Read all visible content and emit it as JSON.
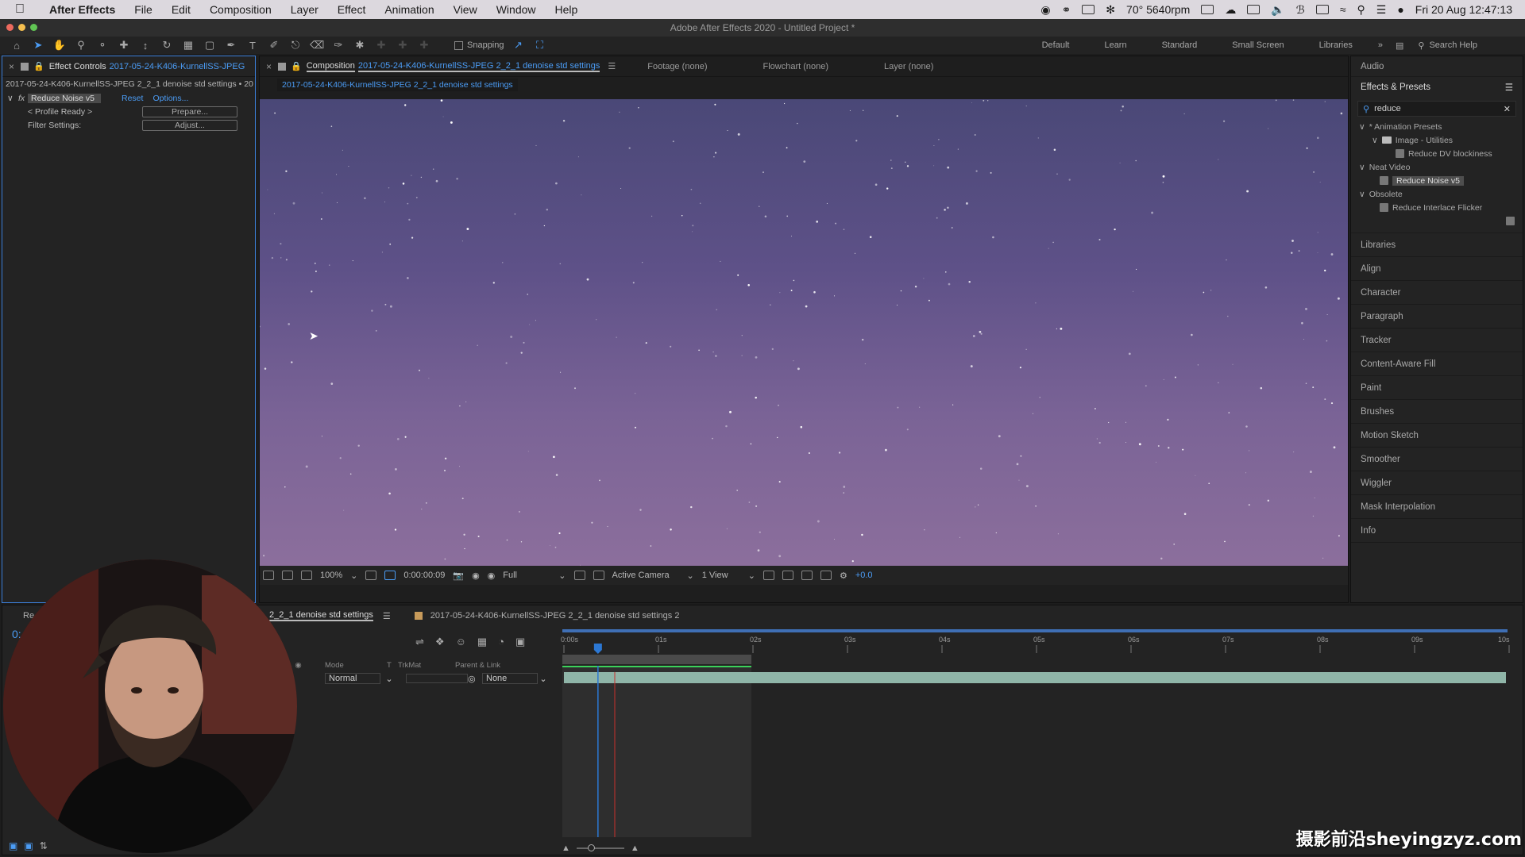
{
  "menubar": {
    "app": "After Effects",
    "items": [
      "File",
      "Edit",
      "Composition",
      "Layer",
      "Effect",
      "Animation",
      "View",
      "Window",
      "Help"
    ],
    "temp": "70° 5640rpm",
    "datetime": "Fri 20 Aug  12:47:13"
  },
  "window": {
    "title": "Adobe After Effects 2020 - Untitled Project *"
  },
  "toolbar": {
    "snapping_label": "Snapping",
    "workspaces": [
      "Default",
      "Learn",
      "Standard",
      "Small Screen",
      "Libraries"
    ],
    "search_label": "Search Help"
  },
  "effect_controls": {
    "tab_label": "Effect Controls",
    "tab_file": "2017-05-24-K406-KurnellSS-JPEG",
    "subtitle": "2017-05-24-K406-KurnellSS-JPEG 2_2_1 denoise std settings • 20",
    "effect_name": "Reduce Noise v5",
    "reset_label": "Reset",
    "options_label": "Options...",
    "profile_label": "< Profile Ready >",
    "prepare_label": "Prepare...",
    "filter_label": "Filter Settings:",
    "adjust_label": "Adjust..."
  },
  "composition": {
    "tab_prefix": "Composition",
    "tab_name": "2017-05-24-K406-KurnellSS-JPEG 2_2_1 denoise std settings",
    "footage": "Footage (none)",
    "flowchart": "Flowchart (none)",
    "layer": "Layer (none)",
    "breadcrumb": "2017-05-24-K406-KurnellSS-JPEG 2_2_1 denoise std settings",
    "zoom": "100%",
    "timecode": "0:00:00:09",
    "resolution": "Full",
    "camera": "Active Camera",
    "views": "1 View",
    "exposure": "+0.0"
  },
  "right_panel": {
    "audio": "Audio",
    "effects_presets": "Effects & Presets",
    "search_value": "reduce",
    "tree": {
      "animation_presets": "* Animation Presets",
      "image_utilities": "Image - Utilities",
      "reduce_dv": "Reduce DV blockiness",
      "neat_video": "Neat Video",
      "reduce_noise": "Reduce Noise v5",
      "obsolete": "Obsolete",
      "reduce_interlace": "Reduce Interlace Flicker"
    },
    "panels": [
      "Libraries",
      "Align",
      "Character",
      "Paragraph",
      "Tracker",
      "Content-Aware Fill",
      "Paint",
      "Brushes",
      "Motion Sketch",
      "Smoother",
      "Wiggler",
      "Mask Interpolation",
      "Info"
    ]
  },
  "timeline": {
    "tab1": "2_2_1 denoise std settings",
    "tab2": "2017-05-24-K406-KurnellSS-JPEG 2_2_1 denoise std settings 2",
    "left_clip": "Re",
    "timecode_clip": "0:",
    "col_mode": "Mode",
    "col_t": "T",
    "col_trkmat": "TrkMat",
    "col_parent": "Parent & Link",
    "mode_value": "Normal",
    "parent_value": "None",
    "ruler": [
      "0:00s",
      "01s",
      "02s",
      "03s",
      "04s",
      "05s",
      "06s",
      "07s",
      "08s",
      "09s",
      "10s"
    ]
  },
  "watermark": "摄影前沿sheyingzyz.com",
  "colors": {
    "accent": "#4b9cf5",
    "work_area": "#3bd25a",
    "layer_bar": "#8fb5a8",
    "playhead": "#2c78d4",
    "indicator": "#c8302c"
  }
}
